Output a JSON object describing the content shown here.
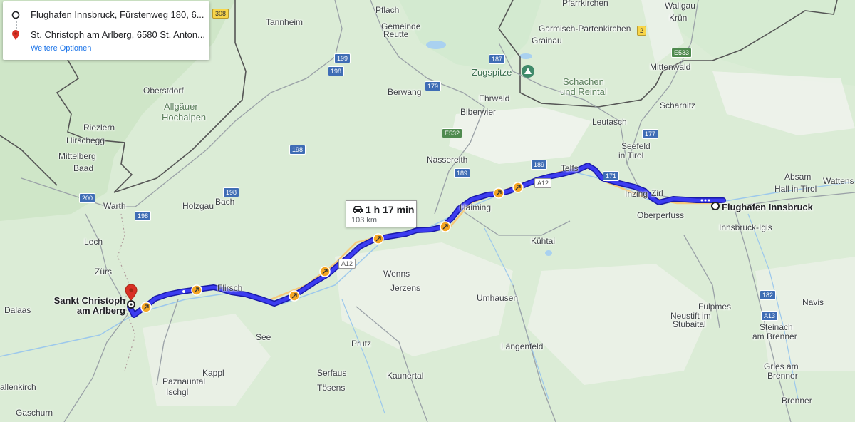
{
  "route_panel": {
    "origin": "Flughafen Innsbruck, Fürstenweg 180, 6...",
    "destination": "St. Christoph am Arlberg, 6580 St. Anton...",
    "more_options": "Weitere Optionen"
  },
  "route_info": {
    "duration": "1 h 17 min",
    "distance": "103 km"
  },
  "markers": {
    "origin_label": "Flughafen Innsbruck",
    "destination_label_line1": "Sankt Christoph",
    "destination_label_line2": "am Arlberg"
  },
  "places": {
    "pflach": "Pflach",
    "gemeinde_reutte_1": "Gemeinde",
    "gemeinde_reutte_2": "Reutte",
    "tannheim": "Tannheim",
    "oberstdorf": "Oberstdorf",
    "allgauer_1": "Allgäuer",
    "allgauer_2": "Hochalpen",
    "riezlern": "Riezlern",
    "hirschegg": "Hirschegg",
    "mittelberg": "Mittelberg",
    "baad": "Baad",
    "warth": "Warth",
    "holzgau": "Holzgau",
    "bach": "Bach",
    "lech": "Lech",
    "zurs": "Zürs",
    "dalaas": "Dalaas",
    "berwang": "Berwang",
    "ehrwald": "Ehrwald",
    "biberwier": "Biberwier",
    "zugspitze": "Zugspitze",
    "schachen_1": "Schachen",
    "schachen_2": "und Reintal",
    "garmisch": "Garmisch-Partenkirchen",
    "grainau": "Grainau",
    "partnach": "Pfarrkirchen",
    "wallgau": "Wallgau",
    "krun": "Krün",
    "mittenwald": "Mittenwald",
    "scharnitz": "Scharnitz",
    "leutasch": "Leutasch",
    "seefeld_1": "Seefeld",
    "seefeld_2": "in Tirol",
    "nassereith": "Nassereith",
    "telfs": "Telfs",
    "inzing": "Inzing",
    "zirl": "Zirl",
    "oberperfuss": "Oberperfuss",
    "haiming": "Haiming",
    "kuhtai": "Kühtai",
    "absam": "Absam",
    "hall": "Hall in Tirol",
    "wattens": "Wattens",
    "innsbruck_igls": "Innsbruck-Igls",
    "flirsch": "Flirsch",
    "wenns": "Wenns",
    "jerzens": "Jerzens",
    "umhausen": "Umhausen",
    "fulpmes": "Fulpmes",
    "neustift_1": "Neustift im",
    "neustift_2": "Stubaital",
    "navis": "Navis",
    "steinach_1": "Steinach",
    "steinach_2": "am Brenner",
    "see": "See",
    "kappl": "Kappl",
    "prutz": "Prutz",
    "langenfeld": "Längenfeld",
    "paznauntal": "Paznauntal",
    "ischgl": "Ischgl",
    "serfaus": "Serfaus",
    "tosens": "Tösens",
    "kaunertal": "Kaunertal",
    "gries_1": "Gries am",
    "gries_2": "Brenner",
    "brenner": "Brenner",
    "gaschurn": "Gaschurn",
    "bartholomaberg": "allenkirch"
  },
  "road_shields": {
    "s308": "308",
    "s199": "199",
    "s198a": "198",
    "s179": "179",
    "s187": "187",
    "s2": "2",
    "e533": "E533",
    "e532": "E532",
    "s189a": "189",
    "s189b": "189",
    "a12a": "A12",
    "s171": "171",
    "s177": "177",
    "s198b": "198",
    "s198c": "198",
    "s200": "200",
    "s198d": "198",
    "a12b": "A12",
    "s182": "182",
    "a13": "A13"
  },
  "colors": {
    "route": "#3c3cf0",
    "route_outline": "#1a1aa8",
    "info_text": "#202124",
    "link": "#1a73e8",
    "destination_pin": "#d93025"
  }
}
